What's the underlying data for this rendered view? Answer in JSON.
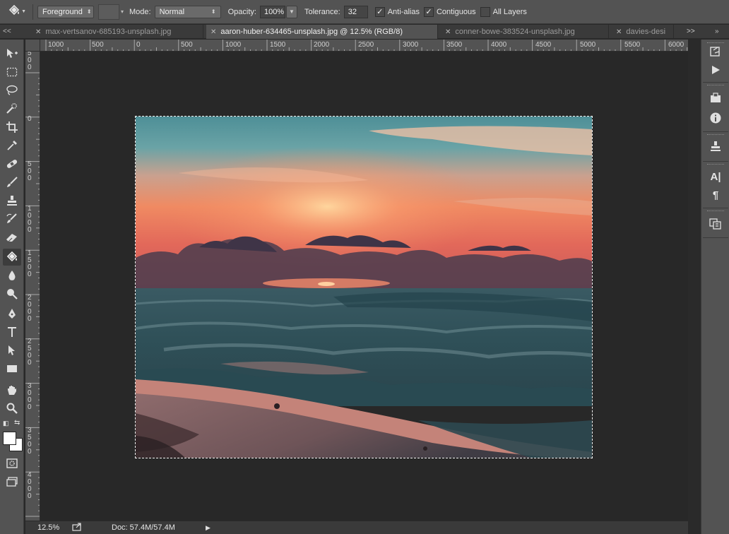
{
  "options_bar": {
    "tool_icon": "paint-bucket-icon",
    "fill_source": "Foreground",
    "mode_label": "Mode:",
    "mode_value": "Normal",
    "opacity_label": "Opacity:",
    "opacity_value": "100%",
    "tolerance_label": "Tolerance:",
    "tolerance_value": "32",
    "anti_alias": {
      "label": "Anti-alias",
      "checked": true
    },
    "contiguous": {
      "label": "Contiguous",
      "checked": true
    },
    "all_layers": {
      "label": "All Layers",
      "checked": false
    }
  },
  "tabs": [
    {
      "label": "max-vertsanov-685193-unsplash.jpg",
      "active": false
    },
    {
      "label": "aaron-huber-634465-unsplash.jpg @ 12.5% (RGB/8)",
      "active": true
    },
    {
      "label": "conner-bowe-383524-unsplash.jpg",
      "active": false
    },
    {
      "label": "davies-desi",
      "active": false
    }
  ],
  "tab_overflow": ">>",
  "panel_collapse": "<<",
  "rulers": {
    "horizontal": [
      "1000",
      "500",
      "0",
      "500",
      "1000",
      "1500",
      "2000",
      "2500",
      "3000",
      "3500",
      "4000",
      "4500",
      "5000",
      "5500",
      "6000"
    ],
    "vertical": [
      "500",
      "0",
      "500",
      "1000",
      "1500",
      "2000",
      "2500",
      "3000",
      "3500",
      "4000"
    ]
  },
  "tools": [
    "move-icon",
    "marquee-icon",
    "lasso-icon",
    "quick-selection-icon",
    "crop-icon",
    "eyedropper-icon",
    "healing-brush-icon",
    "brush-icon",
    "clone-stamp-icon",
    "history-brush-icon",
    "eraser-icon",
    "paint-bucket-icon",
    "blur-icon",
    "dodge-icon",
    "pen-icon",
    "type-icon",
    "path-selection-icon",
    "rectangle-icon",
    "hand-icon",
    "zoom-icon"
  ],
  "status": {
    "zoom": "12.5%",
    "doc_info": "Doc: 57.4M/57.4M"
  },
  "colors": {
    "panel": "#535353",
    "canvas_bg": "#282828",
    "selection": "#ffffff"
  }
}
